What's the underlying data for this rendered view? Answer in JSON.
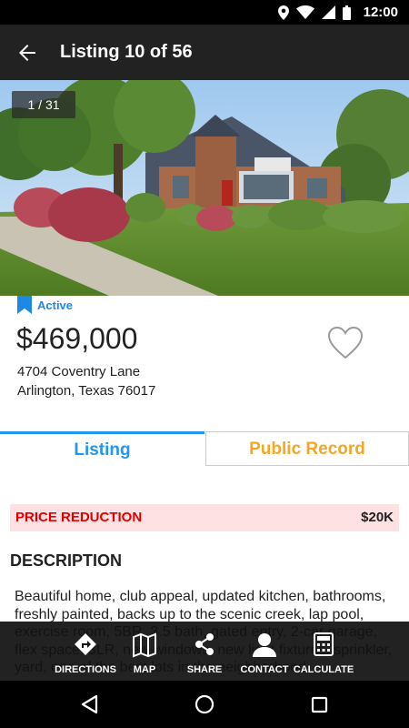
{
  "status_bar": {
    "time": "12:00"
  },
  "app_bar": {
    "title": "Listing 10 of 56"
  },
  "photo": {
    "counter": "1 / 31"
  },
  "listing": {
    "status": "Active",
    "price": "$469,000",
    "address_line1": "4704 Coventry Lane",
    "address_line2": "Arlington, Texas 76017"
  },
  "tabs": {
    "listing": "Listing",
    "public_record": "Public Record"
  },
  "price_reduction": {
    "label": "PRICE REDUCTION",
    "value": "$20K"
  },
  "description": {
    "heading": "DESCRIPTION",
    "text": "Beautiful home, club appeal, updated kitchen, bathrooms, freshly painted, backs up to the scenic creek, lap pool, exercise room, 5BR, 3.5 bath, gated entry, 2-car garage, flex space, 3LR, new windows, new light fixtures, sprinkler, yard, one of the best lots in the neighborhood."
  },
  "actions": {
    "directions": "DIRECTIONS",
    "map": "MAP",
    "share": "SHARE",
    "contact": "CONTACT",
    "calculate": "CALCULATE"
  },
  "colors": {
    "accent": "#2196f3",
    "public_record": "#f5a623",
    "price_reduction_bg": "#fde1e3",
    "price_reduction_text": "#e00000"
  }
}
